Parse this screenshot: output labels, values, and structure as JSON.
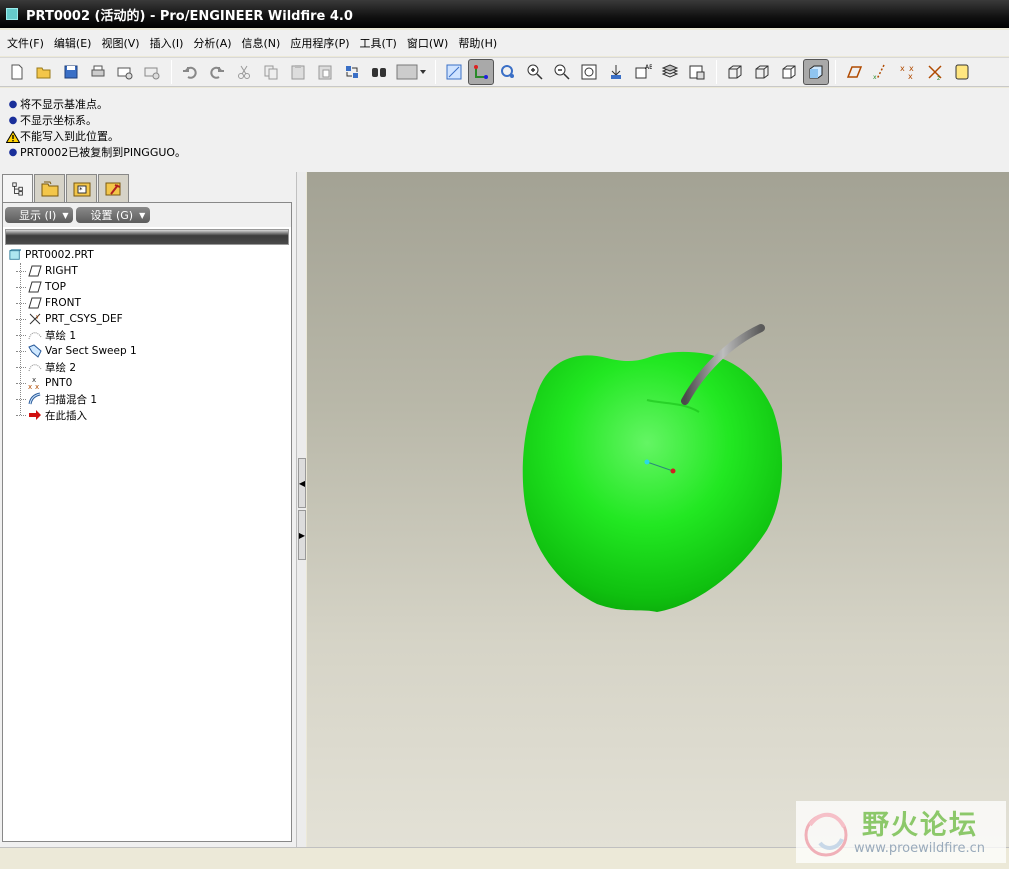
{
  "window": {
    "title": "PRT0002 (活动的) - Pro/ENGINEER Wildfire 4.0"
  },
  "menu": [
    {
      "label": "文件(F)"
    },
    {
      "label": "编辑(E)"
    },
    {
      "label": "视图(V)"
    },
    {
      "label": "插入(I)"
    },
    {
      "label": "分析(A)"
    },
    {
      "label": "信息(N)"
    },
    {
      "label": "应用程序(P)"
    },
    {
      "label": "工具(T)"
    },
    {
      "label": "窗口(W)"
    },
    {
      "label": "帮助(H)"
    }
  ],
  "toolbar": {
    "buttons": [
      "new-icon",
      "open-icon",
      "save-icon",
      "print-icon",
      "send-mail-icon",
      "mail-icon",
      "|",
      "undo-icon",
      "redo-icon",
      "cut-icon",
      "copy-icon",
      "paste-icon",
      "paste-special-icon",
      "regenerate-icon",
      "find-icon",
      "select-box-icon",
      "|",
      "display-style-icon",
      "spin-center-icon",
      "view-manager-icon",
      "zoom-in-icon",
      "zoom-out-icon",
      "refit-icon",
      "reorient-icon",
      "saved-views-icon",
      "layers-icon",
      "view-manager-2-icon",
      "|",
      "wireframe-icon",
      "hidden-line-icon",
      "no-hidden-icon",
      "shading-icon",
      "|",
      "datum-planes-icon",
      "datum-axes-icon",
      "datum-points-icon",
      "csys-icon",
      "annotation-icon"
    ],
    "active": [
      "spin-center-icon",
      "shading-icon"
    ]
  },
  "messages": [
    {
      "type": "info",
      "text": "将不显示基准点。"
    },
    {
      "type": "info",
      "text": "不显示坐标系。"
    },
    {
      "type": "warning",
      "text": "不能写入到此位置。"
    },
    {
      "type": "info",
      "text": "PRT0002已被复制到PINGGUO。"
    }
  ],
  "model_tree": {
    "show_label": "显示 (I)",
    "settings_label": "设置 (G)",
    "root": "PRT0002.PRT",
    "items": [
      {
        "label": "RIGHT",
        "icon": "datum-plane-icon"
      },
      {
        "label": "TOP",
        "icon": "datum-plane-icon"
      },
      {
        "label": "FRONT",
        "icon": "datum-plane-icon"
      },
      {
        "label": "PRT_CSYS_DEF",
        "icon": "csys-icon"
      },
      {
        "label": "草绘 1",
        "icon": "sketch-icon"
      },
      {
        "label": "Var Sect Sweep 1",
        "icon": "sweep-icon"
      },
      {
        "label": "草绘 2",
        "icon": "sketch-icon"
      },
      {
        "label": "PNT0",
        "icon": "datum-point-icon"
      },
      {
        "label": "扫描混合 1",
        "icon": "swept-blend-icon"
      },
      {
        "label": "在此插入",
        "icon": "insert-here-arrow-icon"
      }
    ]
  },
  "colors": {
    "model": "#22e822",
    "stem": "#6e6e6e",
    "watermark": "#8cc86a"
  },
  "watermark": {
    "text": "野火论坛",
    "url": "www.proewildfire.cn"
  }
}
